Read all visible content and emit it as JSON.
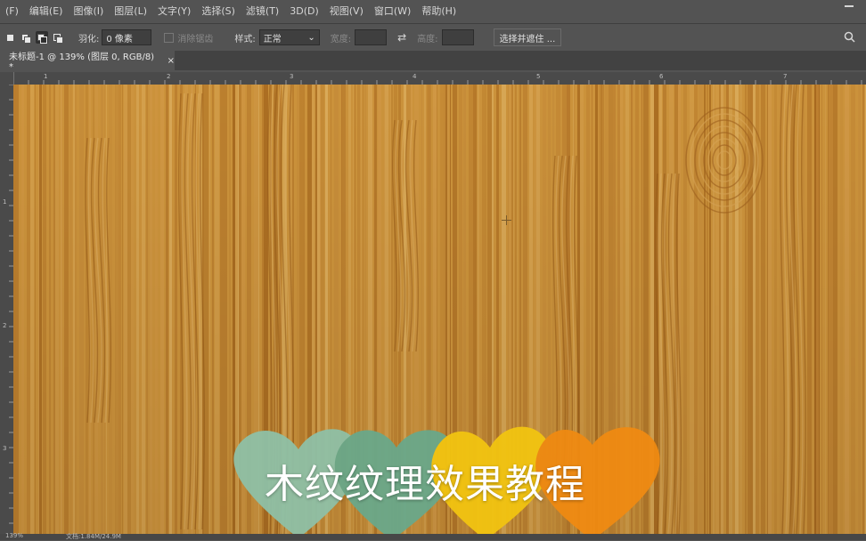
{
  "menubar": {
    "items": [
      "(F)",
      "编辑(E)",
      "图像(I)",
      "图层(L)",
      "文字(Y)",
      "选择(S)",
      "滤镜(T)",
      "3D(D)",
      "视图(V)",
      "窗口(W)",
      "帮助(H)"
    ]
  },
  "options": {
    "feather_label": "羽化:",
    "feather_value": "0 像素",
    "antialias_label": "消除锯齿",
    "style_label": "样式:",
    "style_value": "正常",
    "width_label": "宽度:",
    "height_label": "高度:",
    "select_mask_button": "选择并遮住 ..."
  },
  "document_tab": {
    "title": "未标题-1 @ 139% (图层 0, RGB/8) *",
    "close": "×"
  },
  "rulers": {
    "top": [
      "1",
      "2",
      "3",
      "4",
      "5",
      "6",
      "7"
    ],
    "left": [
      "1",
      "2",
      "3"
    ]
  },
  "status": {
    "zoom": "139%",
    "doc": "文档:1.84M/24.9M"
  },
  "overlay": {
    "caption": "木纹纹理效果教程",
    "heart_colors": [
      "#8fc0a6",
      "#6aa88a",
      "#f2c411",
      "#ef8a12"
    ]
  },
  "colors": {
    "wood_base": "#d79a3c",
    "wood_dark": "#a8661f",
    "wood_light": "#e9b562"
  }
}
